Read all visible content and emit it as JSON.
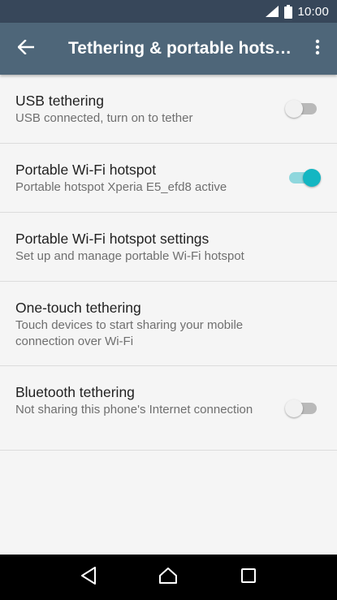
{
  "status_bar": {
    "time": "10:00",
    "icons": [
      "signal-icon",
      "battery-icon"
    ]
  },
  "app_bar": {
    "title": "Tethering & portable hotspot",
    "back_icon": "arrow-back-icon",
    "menu_icon": "more-vert-icon",
    "color": "#4e6679"
  },
  "settings": [
    {
      "title": "USB tethering",
      "subtitle": "USB connected, turn on to tether",
      "toggle": "off"
    },
    {
      "title": "Portable Wi-Fi hotspot",
      "subtitle": "Portable hotspot Xperia E5_efd8 active",
      "toggle": "on"
    },
    {
      "title": "Portable Wi-Fi hotspot settings",
      "subtitle": "Set up and manage portable Wi-Fi hotspot"
    },
    {
      "title": "One-touch tethering",
      "subtitle": "Touch devices to start sharing your mobile connection over Wi-Fi"
    },
    {
      "title": "Bluetooth tethering",
      "subtitle": "Not sharing this phone's Internet connection",
      "toggle": "off"
    }
  ],
  "nav_bar": {
    "buttons": [
      "back-icon",
      "home-icon",
      "recents-icon"
    ]
  },
  "colors": {
    "accent": "#13b6c2",
    "status_bar": "#37475a",
    "background": "#f5f5f5"
  }
}
